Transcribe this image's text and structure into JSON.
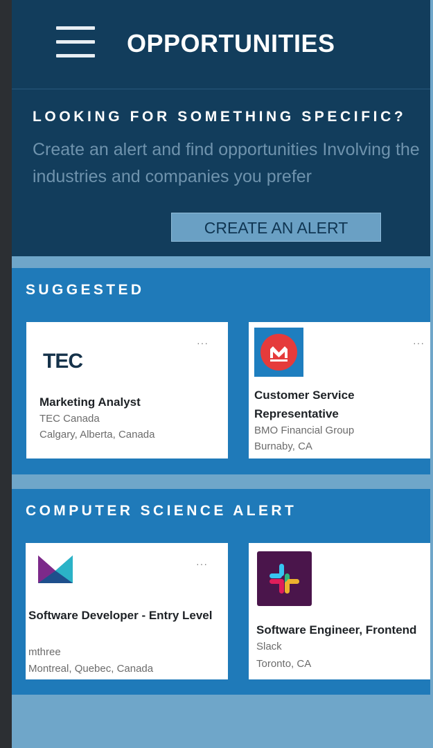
{
  "header": {
    "title": "OPPORTUNITIES",
    "menu_icon": "hamburger-menu-icon"
  },
  "promo": {
    "heading": "LOOKING FOR SOMETHING SPECIFIC?",
    "text": "Create an alert and find opportunities Involving the industries and companies you prefer",
    "button_label": "CREATE AN ALERT"
  },
  "sections": {
    "suggested": {
      "title": "SUGGESTED",
      "cards": [
        {
          "logo_text": "TEC",
          "title": "Marketing Analyst",
          "company": "TEC Canada",
          "location": "Calgary, Alberta, Canada",
          "more": "···"
        },
        {
          "logo_icon": "bmo-logo-icon",
          "title": "Customer Service Representative",
          "company": "BMO Financial Group",
          "location": "Burnaby, CA",
          "more": "···"
        }
      ]
    },
    "cs_alert": {
      "title": "COMPUTER SCIENCE ALERT",
      "cards": [
        {
          "logo_icon": "mthree-logo-icon",
          "title": "Software Developer - Entry Level",
          "company": "mthree",
          "location": "Montreal, Quebec, Canada",
          "more": "···"
        },
        {
          "logo_icon": "slack-logo-icon",
          "title": "Software Engineer, Frontend",
          "company": "Slack",
          "location": "Toronto, CA"
        }
      ]
    }
  },
  "colors": {
    "header_bg": "#123d5c",
    "section_bg": "#1f7ab9",
    "page_bg": "#6fa6c9",
    "button_bg": "#6aa0c4"
  }
}
